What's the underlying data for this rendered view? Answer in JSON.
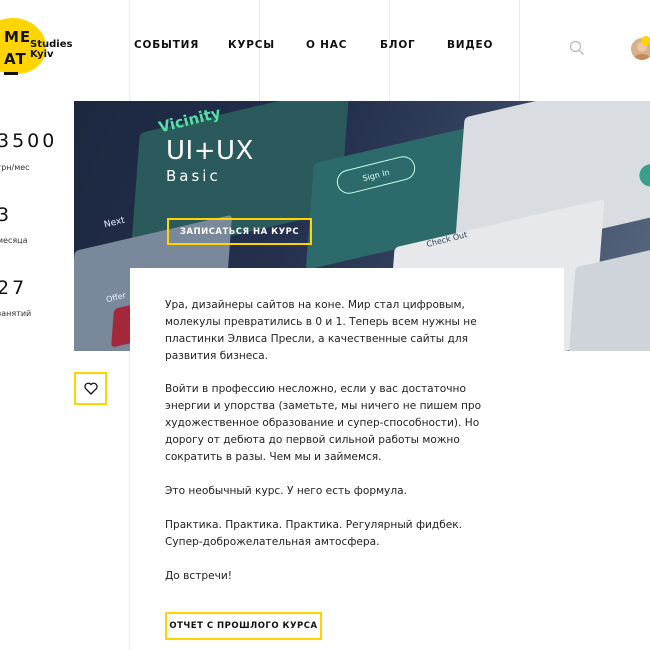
{
  "brand": {
    "logo_line1": "ME",
    "logo_line2": "AT",
    "studio_line1": "Studies",
    "studio_line2": "Kyiv"
  },
  "nav": {
    "items": [
      "СОБЫТИЯ",
      "КУРСЫ",
      "О НАС",
      "БЛОГ",
      "ВИДЕО"
    ],
    "search_icon": "search-icon",
    "avatar": "user-avatar"
  },
  "stats": [
    {
      "value": "3500",
      "label": "грн/мес"
    },
    {
      "value": "3",
      "label": "месяца"
    },
    {
      "value": "27",
      "label": "занятий"
    }
  ],
  "hero": {
    "title": "UI+UX",
    "subtitle": "Basic",
    "cta_label": "ЗАПИСАТЬСЯ НА КУРС",
    "mockup_words": [
      "Vicinity",
      "Sign In",
      "Next",
      "Check Out",
      "Offer"
    ]
  },
  "content": {
    "paragraphs": [
      "Ура, дизайнеры сайтов на коне. Мир стал цифровым, молекулы превратились в 0 и 1. Теперь всем нужны не пластинки Элвиса Пресли, а качественные сайты для развития бизнеса.",
      "Войти в профессию несложно, если у вас достаточно энергии и упорства (заметьте, мы ничего не пишем про художественное образование и супер-способности). Но дорогу от дебюта до первой сильной работы можно сократить в разы. Чем мы и займемся.",
      "Это необычный курс. У него есть формула.",
      "Практика. Практика. Практика. Регулярный фидбек. Супер-доброжелательная амтосфера.",
      "До встречи!"
    ],
    "report_button": "ОТЧЕТ С ПРОШЛОГО КУРСА"
  },
  "favorite_icon": "heart-icon",
  "colors": {
    "accent": "#ffd400",
    "hero_bg": "#1c2740",
    "text": "#111111"
  }
}
